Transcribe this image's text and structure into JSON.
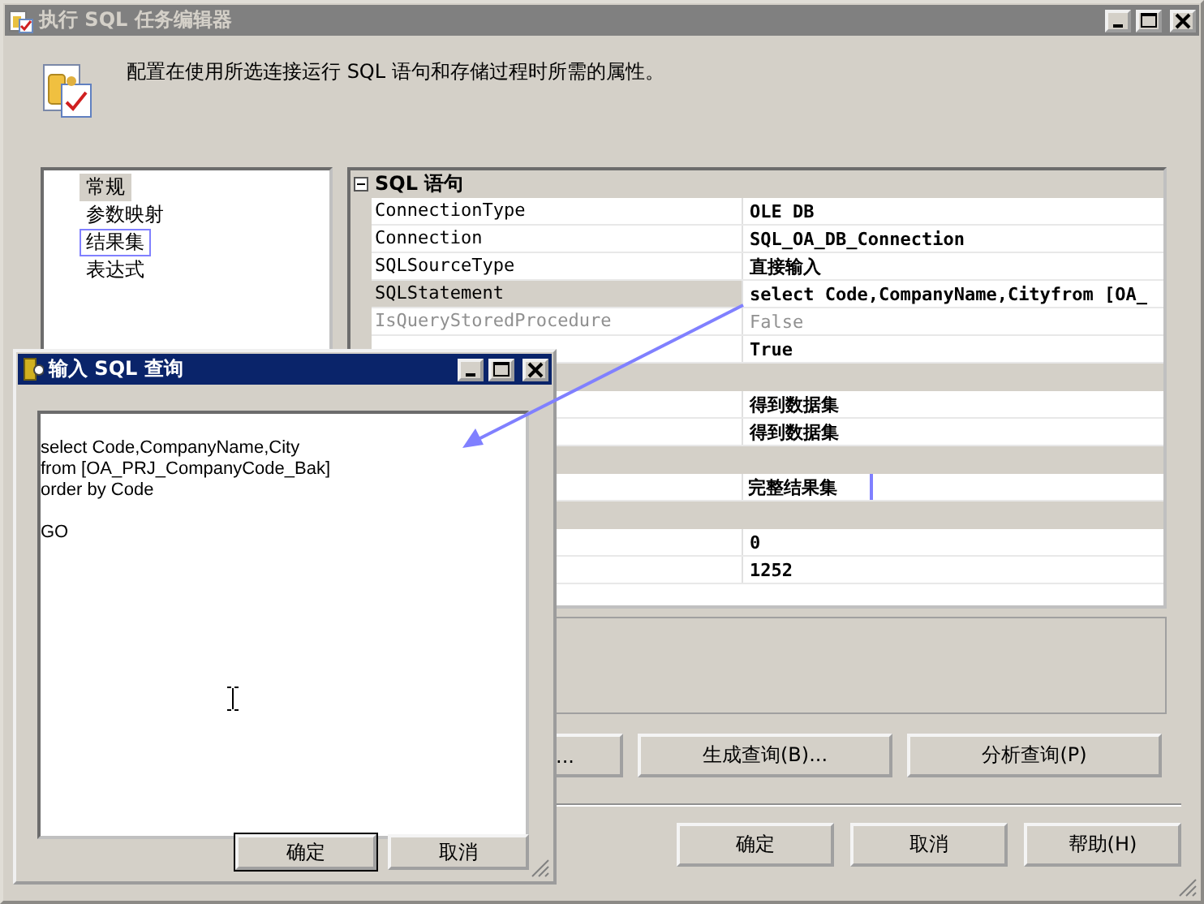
{
  "window": {
    "title": "执行 SQL 任务编辑器",
    "description": "配置在使用所选连接运行 SQL 语句和存储过程时所需的属性。"
  },
  "nav": [
    {
      "label": "常规",
      "selected": true,
      "annotated": false
    },
    {
      "label": "参数映射",
      "selected": false,
      "annotated": false
    },
    {
      "label": "结果集",
      "selected": false,
      "annotated": true
    },
    {
      "label": "表达式",
      "selected": false,
      "annotated": false
    }
  ],
  "properties": [
    {
      "kind": "category",
      "label": "SQL 语句",
      "expanded": true
    },
    {
      "kind": "property",
      "name": "ConnectionType",
      "value": "OLE DB",
      "selected": false,
      "disabled": false,
      "annotated": false
    },
    {
      "kind": "property",
      "name": "Connection",
      "value": "SQL_OA_DB_Connection",
      "selected": false,
      "disabled": false,
      "annotated": false
    },
    {
      "kind": "property",
      "name": "SQLSourceType",
      "value": "直接输入",
      "selected": false,
      "disabled": false,
      "annotated": false
    },
    {
      "kind": "property",
      "name": "SQLStatement",
      "value": "select Code,CompanyName,Cityfrom [OA_",
      "selected": true,
      "disabled": false,
      "annotated": false
    },
    {
      "kind": "property",
      "name": "IsQueryStoredProcedure",
      "value": "False",
      "selected": false,
      "disabled": true,
      "annotated": false
    },
    {
      "kind": "property",
      "value": "True",
      "disabled": false,
      "annotated": false
    },
    {
      "kind": "category"
    },
    {
      "kind": "property",
      "value": "得到数据集",
      "disabled": false,
      "annotated": false
    },
    {
      "kind": "property",
      "value": "得到数据集",
      "disabled": false,
      "annotated": false
    },
    {
      "kind": "category"
    },
    {
      "kind": "property",
      "value": "完整结果集",
      "disabled": false,
      "annotated": true
    },
    {
      "kind": "category"
    },
    {
      "kind": "property",
      "value": "0",
      "disabled": false,
      "annotated": false
    },
    {
      "kind": "property",
      "value": "1252",
      "disabled": false,
      "annotated": false
    }
  ],
  "action_buttons": [
    "...",
    "生成查询(B)...",
    "分析查询(P)"
  ],
  "dialog_buttons": [
    "确定",
    "取消",
    "帮助(H)"
  ],
  "query_dialog": {
    "title": "输入 SQL 查询",
    "query": "select Code,CompanyName,City\nfrom [OA_PRJ_CompanyCode_Bak]\norder by Code\n\nGO",
    "buttons": [
      "确定",
      "取消"
    ]
  }
}
